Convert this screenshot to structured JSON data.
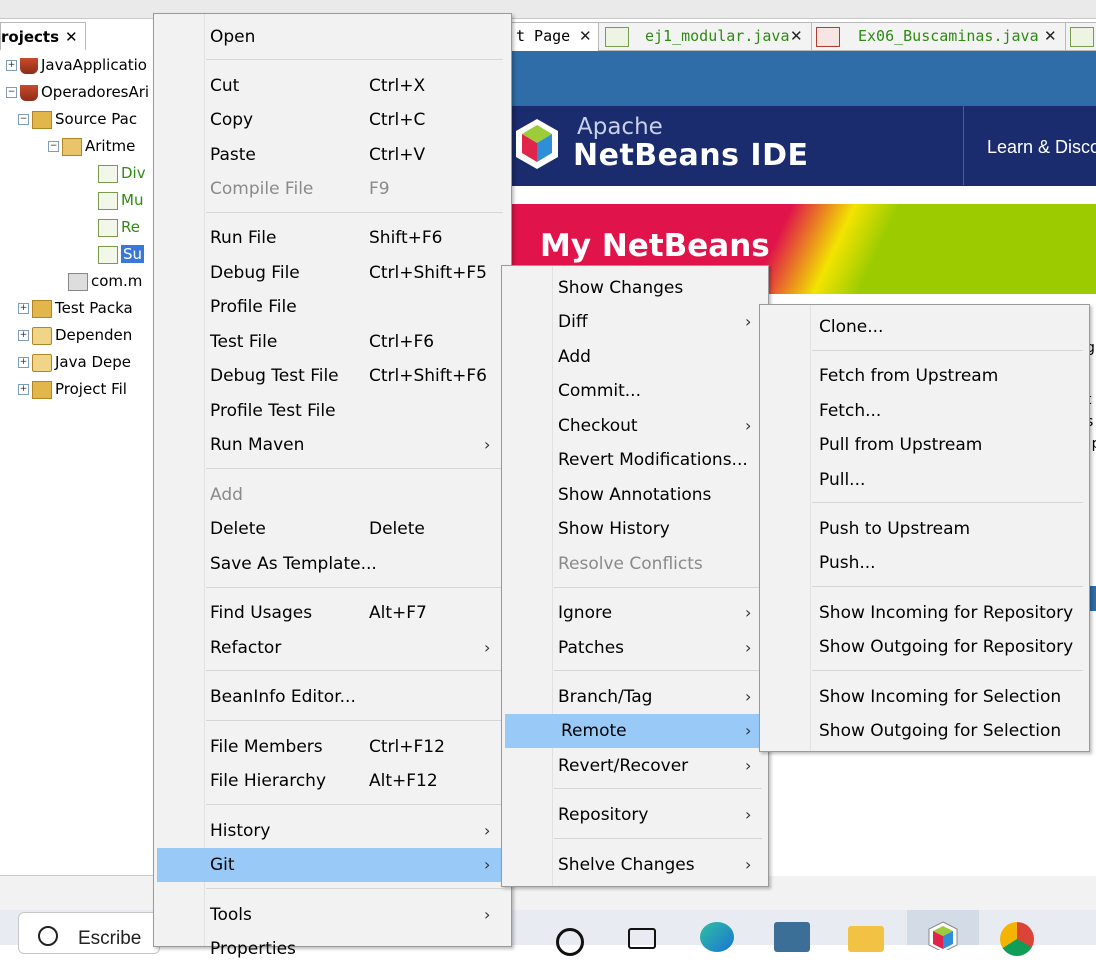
{
  "projects_panel": {
    "tab_label": "rojects",
    "close": "✕",
    "tree": [
      {
        "label": "JavaApplicatio",
        "icon": "coffee-cup-icon"
      },
      {
        "label": "OperadoresAri",
        "icon": "coffee-cup-icon"
      },
      {
        "label": "Source Pac",
        "icon": "folder-icon"
      },
      {
        "label": "Aritme",
        "icon": "package-icon"
      },
      {
        "label": "Div",
        "icon": "java-file-icon"
      },
      {
        "label": "Mu",
        "icon": "java-file-icon"
      },
      {
        "label": "Re",
        "icon": "java-file-icon"
      },
      {
        "label": "Su",
        "icon": "java-file-icon"
      },
      {
        "label": "com.m",
        "icon": "package-icon"
      },
      {
        "label": "Test Packa",
        "icon": "folder-icon"
      },
      {
        "label": "Dependen",
        "icon": "jar-icon"
      },
      {
        "label": "Java Depe",
        "icon": "jar-icon"
      },
      {
        "label": "Project Fil",
        "icon": "folder-icon"
      }
    ]
  },
  "editor_tabs": [
    {
      "label": "t Page",
      "close": "✕"
    },
    {
      "label": "ej1_modular.java",
      "close": "✕"
    },
    {
      "label": "Ex06_Buscaminas.java",
      "close": "✕"
    }
  ],
  "start_page": {
    "apache": "Apache",
    "ide_title": "NetBeans IDE",
    "learn": "Learn & Disco",
    "my_netbeans": "My NetBeans",
    "right_text": [
      "g",
      "t",
      "s",
      "!p"
    ]
  },
  "context_menu": {
    "items": [
      {
        "label": "Open"
      },
      {
        "label": "Cut",
        "shortcut": "Ctrl+X"
      },
      {
        "label": "Copy",
        "shortcut": "Ctrl+C"
      },
      {
        "label": "Paste",
        "shortcut": "Ctrl+V"
      },
      {
        "label": "Compile File",
        "shortcut": "F9",
        "disabled": true
      },
      {
        "label": "Run File",
        "shortcut": "Shift+F6"
      },
      {
        "label": "Debug File",
        "shortcut": "Ctrl+Shift+F5"
      },
      {
        "label": "Profile File"
      },
      {
        "label": "Test File",
        "shortcut": "Ctrl+F6"
      },
      {
        "label": "Debug Test File",
        "shortcut": "Ctrl+Shift+F6"
      },
      {
        "label": "Profile Test File"
      },
      {
        "label": "Run Maven",
        "submenu": true
      },
      {
        "label": "Add",
        "disabled": true
      },
      {
        "label": "Delete",
        "shortcut": "Delete"
      },
      {
        "label": "Save As Template..."
      },
      {
        "label": "Find Usages",
        "shortcut": "Alt+F7"
      },
      {
        "label": "Refactor",
        "submenu": true
      },
      {
        "label": "BeanInfo Editor..."
      },
      {
        "label": "File Members",
        "shortcut": "Ctrl+F12"
      },
      {
        "label": "File Hierarchy",
        "shortcut": "Alt+F12"
      },
      {
        "label": "History",
        "submenu": true
      },
      {
        "label": "Git",
        "submenu": true,
        "highlighted": true
      },
      {
        "label": "Tools",
        "submenu": true
      },
      {
        "label": "Properties"
      }
    ]
  },
  "git_menu": {
    "items": [
      {
        "label": "Show Changes"
      },
      {
        "label": "Diff",
        "submenu": true
      },
      {
        "label": "Add"
      },
      {
        "label": "Commit..."
      },
      {
        "label": "Checkout",
        "submenu": true
      },
      {
        "label": "Revert Modifications..."
      },
      {
        "label": "Show Annotations"
      },
      {
        "label": "Show History"
      },
      {
        "label": "Resolve Conflicts",
        "disabled": true
      },
      {
        "label": "Ignore",
        "submenu": true
      },
      {
        "label": "Patches",
        "submenu": true
      },
      {
        "label": "Branch/Tag",
        "submenu": true
      },
      {
        "label": "Remote",
        "submenu": true,
        "highlighted": true
      },
      {
        "label": "Revert/Recover",
        "submenu": true
      },
      {
        "label": "Repository",
        "submenu": true
      },
      {
        "label": "Shelve Changes",
        "submenu": true
      }
    ]
  },
  "remote_menu": {
    "items": [
      {
        "label": "Clone..."
      },
      {
        "label": "Fetch from Upstream"
      },
      {
        "label": "Fetch..."
      },
      {
        "label": "Pull from Upstream"
      },
      {
        "label": "Pull..."
      },
      {
        "label": "Push to Upstream"
      },
      {
        "label": "Push..."
      },
      {
        "label": "Show Incoming for Repository"
      },
      {
        "label": "Show Outgoing for Repository"
      },
      {
        "label": "Show Incoming for Selection"
      },
      {
        "label": "Show Outgoing for Selection"
      }
    ]
  },
  "taskbar": {
    "search_text": "Escribe",
    "icons": [
      "search-icon",
      "task-view-icon",
      "edge-icon",
      "mysql-workbench-icon",
      "file-explorer-icon",
      "netbeans-icon",
      "chrome-icon"
    ]
  },
  "colors": {
    "menu_bg": "#f2f2f2",
    "highlight": "#99c9f6",
    "banner": "#1a2b6e",
    "tab_green": "#2f8a14"
  }
}
